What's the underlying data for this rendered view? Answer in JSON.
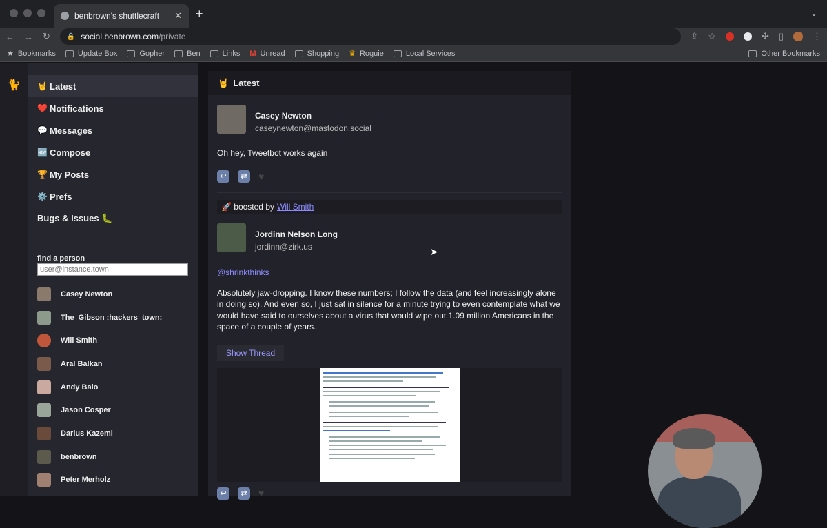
{
  "browser": {
    "tab_title": "benbrown's shuttlecraft",
    "tab_close": "✕",
    "new_tab": "+",
    "tab_menu": "⌄",
    "url_domain": "social.benbrown.com",
    "url_path": "/private",
    "bookmarks": [
      {
        "label": "Bookmarks",
        "icon": "star-icon"
      },
      {
        "label": "Update Box",
        "icon": "bookmark-icon"
      },
      {
        "label": "Gopher",
        "icon": "bookmark-icon"
      },
      {
        "label": "Ben",
        "icon": "folder-icon"
      },
      {
        "label": "Links",
        "icon": "folder-icon"
      },
      {
        "label": "Unread",
        "icon": "gmail-icon"
      },
      {
        "label": "Shopping",
        "icon": "folder-icon"
      },
      {
        "label": "Roguie",
        "icon": "roguie-icon"
      },
      {
        "label": "Local Services",
        "icon": "folder-icon"
      }
    ],
    "other_bookmarks": "Other Bookmarks"
  },
  "sidebar": {
    "nav": [
      {
        "emoji": "🤘",
        "label": "Latest"
      },
      {
        "emoji": "❤️",
        "label": "Notifications"
      },
      {
        "emoji": "💬",
        "label": "Messages"
      },
      {
        "emoji": "🆕",
        "label": "Compose"
      },
      {
        "emoji": "🏆",
        "label": "My Posts"
      },
      {
        "emoji": "⚙️",
        "label": "Prefs"
      },
      {
        "emoji": "",
        "label": "Bugs & Issues 🐛"
      }
    ],
    "find_label": "find a person",
    "find_placeholder": "user@instance.town",
    "people": [
      "Casey Newton",
      "The_Gibson :hackers_town:",
      "Will Smith",
      "Aral Balkan",
      "Andy Baio",
      "Jason Cosper",
      "Darius Kazemi",
      "benbrown",
      "Peter Merholz"
    ]
  },
  "feed": {
    "header_emoji": "🤘",
    "header": "Latest",
    "post1": {
      "name": "Casey Newton",
      "handle": "caseynewton@mastodon.social",
      "content": "Oh hey, Tweetbot works again"
    },
    "post2": {
      "boost_prefix": "🚀 boosted by",
      "boosted_by": "Will Smith",
      "name": "Jordinn Nelson Long",
      "handle": "jordinn@zirk.us",
      "mention": "@shrinkthinks",
      "content": "Absolutely jaw-dropping. I know these numbers; I follow the data (and feel increasingly alone in doing so). And even so, I just sat in silence for a minute trying to even contemplate what we would have said to ourselves about a virus that would wipe out 1.09 million Americans in the space of a couple of years.",
      "show_thread": "Show Thread"
    }
  },
  "colors": {
    "link": "#8c8cff",
    "sidebar_bg": "#26262e",
    "feed_bg": "#22222a"
  }
}
